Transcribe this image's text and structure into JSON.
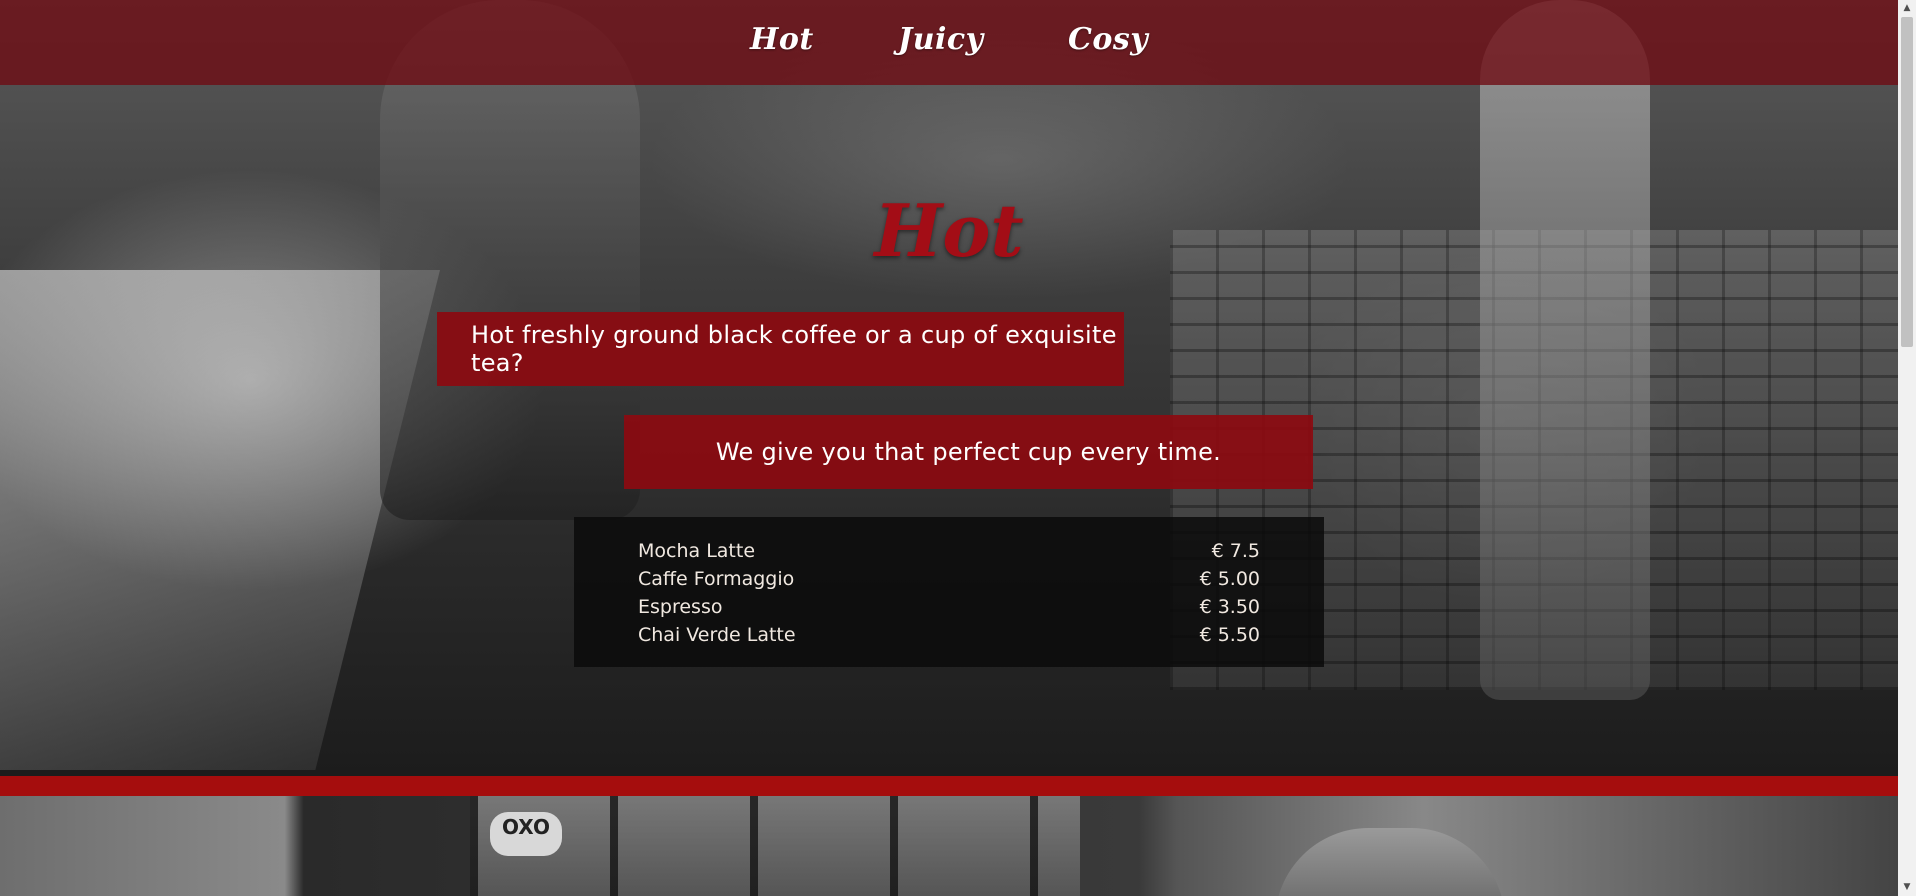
{
  "nav": {
    "items": [
      {
        "label": "Hot"
      },
      {
        "label": "Juicy"
      },
      {
        "label": "Cosy"
      }
    ]
  },
  "hero": {
    "title": "Hot",
    "tagline": "Hot freshly ground black coffee or a cup of exquisite tea?",
    "subtagline": "We give you that perfect cup every time."
  },
  "menu": {
    "items": [
      {
        "name": "Mocha Latte",
        "price": "€ 7.5"
      },
      {
        "name": "Caffe Formaggio",
        "price": "€ 5.00"
      },
      {
        "name": "Espresso",
        "price": "€ 3.50"
      },
      {
        "name": "Chai Verde Latte",
        "price": "€ 5.50"
      }
    ]
  },
  "lower_image": {
    "sign_text": "OXO"
  },
  "colors": {
    "brand_red": "#a50d0d",
    "nav_bg": "#6e0a12",
    "banner_bg": "#8c0a10",
    "menu_bg": "#0a0a0a"
  },
  "icons": {
    "scroll_up": "triangle-up-icon",
    "scroll_down": "triangle-down-icon"
  }
}
